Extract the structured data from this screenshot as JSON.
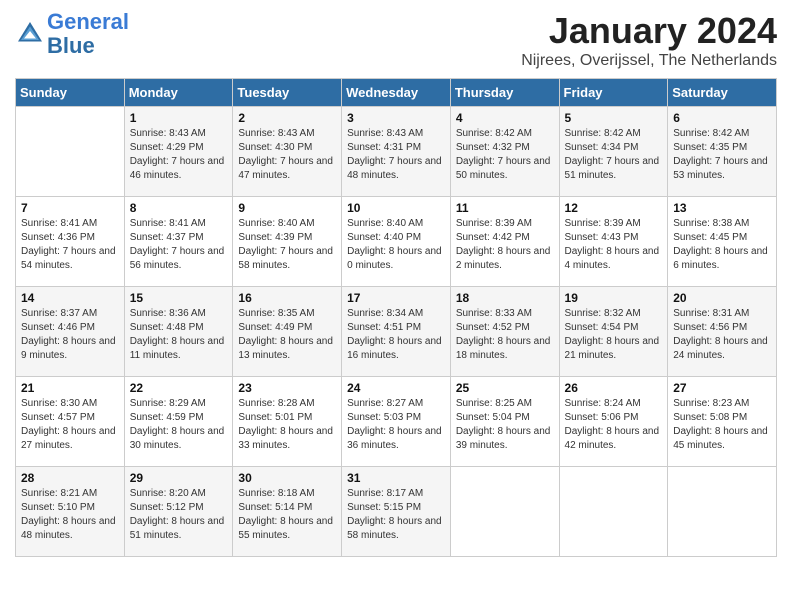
{
  "header": {
    "logo_line1": "General",
    "logo_line2": "Blue",
    "month": "January 2024",
    "location": "Nijrees, Overijssel, The Netherlands"
  },
  "weekdays": [
    "Sunday",
    "Monday",
    "Tuesday",
    "Wednesday",
    "Thursday",
    "Friday",
    "Saturday"
  ],
  "weeks": [
    [
      {
        "day": "",
        "sunrise": "",
        "sunset": "",
        "daylight": ""
      },
      {
        "day": "1",
        "sunrise": "Sunrise: 8:43 AM",
        "sunset": "Sunset: 4:29 PM",
        "daylight": "Daylight: 7 hours and 46 minutes."
      },
      {
        "day": "2",
        "sunrise": "Sunrise: 8:43 AM",
        "sunset": "Sunset: 4:30 PM",
        "daylight": "Daylight: 7 hours and 47 minutes."
      },
      {
        "day": "3",
        "sunrise": "Sunrise: 8:43 AM",
        "sunset": "Sunset: 4:31 PM",
        "daylight": "Daylight: 7 hours and 48 minutes."
      },
      {
        "day": "4",
        "sunrise": "Sunrise: 8:42 AM",
        "sunset": "Sunset: 4:32 PM",
        "daylight": "Daylight: 7 hours and 50 minutes."
      },
      {
        "day": "5",
        "sunrise": "Sunrise: 8:42 AM",
        "sunset": "Sunset: 4:34 PM",
        "daylight": "Daylight: 7 hours and 51 minutes."
      },
      {
        "day": "6",
        "sunrise": "Sunrise: 8:42 AM",
        "sunset": "Sunset: 4:35 PM",
        "daylight": "Daylight: 7 hours and 53 minutes."
      }
    ],
    [
      {
        "day": "7",
        "sunrise": "Sunrise: 8:41 AM",
        "sunset": "Sunset: 4:36 PM",
        "daylight": "Daylight: 7 hours and 54 minutes."
      },
      {
        "day": "8",
        "sunrise": "Sunrise: 8:41 AM",
        "sunset": "Sunset: 4:37 PM",
        "daylight": "Daylight: 7 hours and 56 minutes."
      },
      {
        "day": "9",
        "sunrise": "Sunrise: 8:40 AM",
        "sunset": "Sunset: 4:39 PM",
        "daylight": "Daylight: 7 hours and 58 minutes."
      },
      {
        "day": "10",
        "sunrise": "Sunrise: 8:40 AM",
        "sunset": "Sunset: 4:40 PM",
        "daylight": "Daylight: 8 hours and 0 minutes."
      },
      {
        "day": "11",
        "sunrise": "Sunrise: 8:39 AM",
        "sunset": "Sunset: 4:42 PM",
        "daylight": "Daylight: 8 hours and 2 minutes."
      },
      {
        "day": "12",
        "sunrise": "Sunrise: 8:39 AM",
        "sunset": "Sunset: 4:43 PM",
        "daylight": "Daylight: 8 hours and 4 minutes."
      },
      {
        "day": "13",
        "sunrise": "Sunrise: 8:38 AM",
        "sunset": "Sunset: 4:45 PM",
        "daylight": "Daylight: 8 hours and 6 minutes."
      }
    ],
    [
      {
        "day": "14",
        "sunrise": "Sunrise: 8:37 AM",
        "sunset": "Sunset: 4:46 PM",
        "daylight": "Daylight: 8 hours and 9 minutes."
      },
      {
        "day": "15",
        "sunrise": "Sunrise: 8:36 AM",
        "sunset": "Sunset: 4:48 PM",
        "daylight": "Daylight: 8 hours and 11 minutes."
      },
      {
        "day": "16",
        "sunrise": "Sunrise: 8:35 AM",
        "sunset": "Sunset: 4:49 PM",
        "daylight": "Daylight: 8 hours and 13 minutes."
      },
      {
        "day": "17",
        "sunrise": "Sunrise: 8:34 AM",
        "sunset": "Sunset: 4:51 PM",
        "daylight": "Daylight: 8 hours and 16 minutes."
      },
      {
        "day": "18",
        "sunrise": "Sunrise: 8:33 AM",
        "sunset": "Sunset: 4:52 PM",
        "daylight": "Daylight: 8 hours and 18 minutes."
      },
      {
        "day": "19",
        "sunrise": "Sunrise: 8:32 AM",
        "sunset": "Sunset: 4:54 PM",
        "daylight": "Daylight: 8 hours and 21 minutes."
      },
      {
        "day": "20",
        "sunrise": "Sunrise: 8:31 AM",
        "sunset": "Sunset: 4:56 PM",
        "daylight": "Daylight: 8 hours and 24 minutes."
      }
    ],
    [
      {
        "day": "21",
        "sunrise": "Sunrise: 8:30 AM",
        "sunset": "Sunset: 4:57 PM",
        "daylight": "Daylight: 8 hours and 27 minutes."
      },
      {
        "day": "22",
        "sunrise": "Sunrise: 8:29 AM",
        "sunset": "Sunset: 4:59 PM",
        "daylight": "Daylight: 8 hours and 30 minutes."
      },
      {
        "day": "23",
        "sunrise": "Sunrise: 8:28 AM",
        "sunset": "Sunset: 5:01 PM",
        "daylight": "Daylight: 8 hours and 33 minutes."
      },
      {
        "day": "24",
        "sunrise": "Sunrise: 8:27 AM",
        "sunset": "Sunset: 5:03 PM",
        "daylight": "Daylight: 8 hours and 36 minutes."
      },
      {
        "day": "25",
        "sunrise": "Sunrise: 8:25 AM",
        "sunset": "Sunset: 5:04 PM",
        "daylight": "Daylight: 8 hours and 39 minutes."
      },
      {
        "day": "26",
        "sunrise": "Sunrise: 8:24 AM",
        "sunset": "Sunset: 5:06 PM",
        "daylight": "Daylight: 8 hours and 42 minutes."
      },
      {
        "day": "27",
        "sunrise": "Sunrise: 8:23 AM",
        "sunset": "Sunset: 5:08 PM",
        "daylight": "Daylight: 8 hours and 45 minutes."
      }
    ],
    [
      {
        "day": "28",
        "sunrise": "Sunrise: 8:21 AM",
        "sunset": "Sunset: 5:10 PM",
        "daylight": "Daylight: 8 hours and 48 minutes."
      },
      {
        "day": "29",
        "sunrise": "Sunrise: 8:20 AM",
        "sunset": "Sunset: 5:12 PM",
        "daylight": "Daylight: 8 hours and 51 minutes."
      },
      {
        "day": "30",
        "sunrise": "Sunrise: 8:18 AM",
        "sunset": "Sunset: 5:14 PM",
        "daylight": "Daylight: 8 hours and 55 minutes."
      },
      {
        "day": "31",
        "sunrise": "Sunrise: 8:17 AM",
        "sunset": "Sunset: 5:15 PM",
        "daylight": "Daylight: 8 hours and 58 minutes."
      },
      {
        "day": "",
        "sunrise": "",
        "sunset": "",
        "daylight": ""
      },
      {
        "day": "",
        "sunrise": "",
        "sunset": "",
        "daylight": ""
      },
      {
        "day": "",
        "sunrise": "",
        "sunset": "",
        "daylight": ""
      }
    ]
  ]
}
